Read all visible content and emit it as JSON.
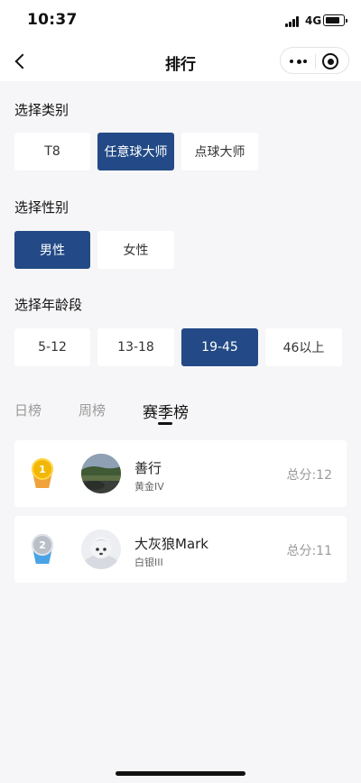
{
  "status_bar": {
    "time": "10:37",
    "network": "4G"
  },
  "nav": {
    "title": "排行",
    "icons": [
      "back-icon",
      "more-icon",
      "close-icon"
    ]
  },
  "category": {
    "title": "选择类别",
    "options": [
      {
        "label": "T8",
        "selected": false
      },
      {
        "label": "任意球大师",
        "selected": true
      },
      {
        "label": "点球大师",
        "selected": false
      }
    ]
  },
  "gender": {
    "title": "选择性别",
    "options": [
      {
        "label": "男性",
        "selected": true
      },
      {
        "label": "女性",
        "selected": false
      }
    ]
  },
  "age": {
    "title": "选择年龄段",
    "options": [
      {
        "label": "5-12",
        "selected": false
      },
      {
        "label": "13-18",
        "selected": false
      },
      {
        "label": "19-45",
        "selected": true
      },
      {
        "label": "46以上",
        "selected": false
      }
    ]
  },
  "tabs": [
    {
      "label": "日榜",
      "active": false
    },
    {
      "label": "周榜",
      "active": false
    },
    {
      "label": "赛季榜",
      "active": true
    }
  ],
  "ranking": [
    {
      "rank": "1",
      "medal": "gold-medal-icon",
      "name": "善行",
      "level": "黄金IV",
      "score": "总分:12"
    },
    {
      "rank": "2",
      "medal": "silver-medal-icon",
      "name": "大灰狼Mark",
      "level": "白银III",
      "score": "总分:11"
    }
  ],
  "colors": {
    "accent": "#234a86",
    "gold": "#f2b705",
    "silver": "#b9bec7",
    "silver_ribbon": "#4aa3e6",
    "gold_ribbon": "#f0a23a"
  }
}
